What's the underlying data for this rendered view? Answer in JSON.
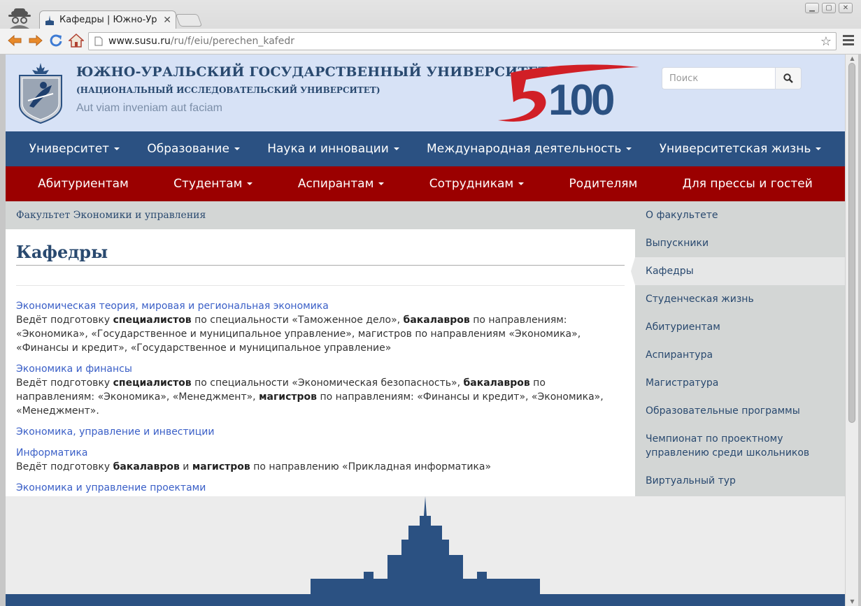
{
  "browser": {
    "tab_title": "Кафедры | Южно-Ур",
    "tab_close": "✕",
    "url_host": "www.susu.ru",
    "url_path": "/ru/f/eiu/perechen_kafedr",
    "star": "☆"
  },
  "header": {
    "university_name": "ЮЖНО-УРАЛЬСКИЙ ГОСУДАРСТВЕННЫЙ УНИВЕРСИТЕТ",
    "university_sub": "(НАЦИОНАЛЬНЫЙ ИССЛЕДОВАТЕЛЬСКИЙ УНИВЕРСИТЕТ)",
    "motto": "Aut viam inveniam aut faciam",
    "search_placeholder": "Поиск"
  },
  "nav_main": [
    {
      "label": "Университет"
    },
    {
      "label": "Образование"
    },
    {
      "label": "Наука и инновации"
    },
    {
      "label": "Международная деятельность"
    },
    {
      "label": "Университетская жизнь"
    }
  ],
  "nav_sub": [
    {
      "label": "Абитуриентам"
    },
    {
      "label": "Студентам"
    },
    {
      "label": "Аспирантам"
    },
    {
      "label": "Сотрудникам"
    },
    {
      "label": "Родителям"
    },
    {
      "label": "Для прессы и гостей"
    }
  ],
  "breadcrumb": "Факультет Экономики и управления",
  "page_title": "Кафедры",
  "departments": [
    {
      "name": "Экономическая теория, мировая и региональная экономика",
      "d0": "Ведёт подготовку ",
      "b0": "специалистов",
      "d1": " по специальности «Таможенное дело», ",
      "b1": "бакалавров",
      "d2": " по направлениям: «Экономика», «Государственное и муниципальное управление», магистров по направлениям «Экономика», «Финансы и кредит», «Государственное и муниципальное управление»"
    },
    {
      "name": "Экономика и финансы",
      "d0": "Ведёт подготовку ",
      "b0": "специалистов",
      "d1": " по специальности «Экономическая безопасность», ",
      "b1": "бакалавров",
      "d2": " по направлениям: «Экономика», «Менеджмент», ",
      "b2": "магистров",
      "d3": " по направлениям: «Финансы и кредит», «Экономика», «Менеджмент»."
    },
    {
      "name": "Экономика, управление и инвестиции"
    },
    {
      "name": "Информатика",
      "d0": "Ведёт подготовку ",
      "b0": "бакалавров",
      "d1": " и ",
      "b1": "магистров",
      "d2": " по направлению «Прикладная информатика»"
    },
    {
      "name": "Экономика и управление проектами"
    }
  ],
  "sidebar": {
    "items": [
      {
        "label": "О факультете"
      },
      {
        "label": "Выпускники"
      },
      {
        "label": "Кафедры"
      },
      {
        "label": "Студенческая жизнь"
      },
      {
        "label": "Абитуриентам"
      },
      {
        "label": "Аспирантура"
      },
      {
        "label": "Магистратура"
      },
      {
        "label": "Образовательные программы"
      },
      {
        "label": "Чемпионат по проектному управлению среди школьников"
      },
      {
        "label": "Виртуальный тур"
      }
    ],
    "active_index": 2
  },
  "colors": {
    "header_bg": "#d7e2f6",
    "nav_main": "#2b5182",
    "nav_sub": "#9b0000",
    "link": "#3a5fc7",
    "skyline": "#2b5182"
  }
}
